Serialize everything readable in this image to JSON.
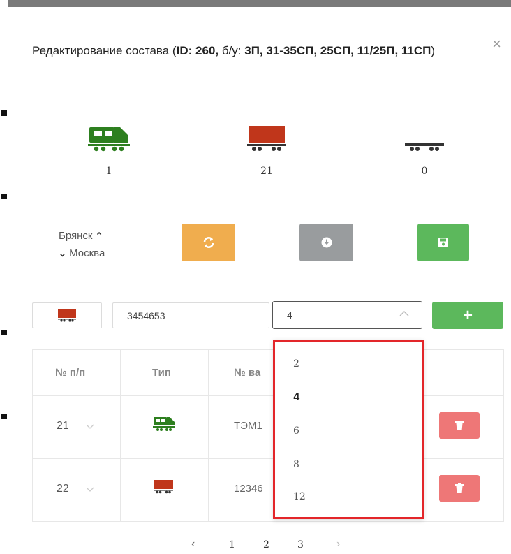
{
  "modal": {
    "title_prefix": "Редактирование состава (",
    "title_id": "ID: 260,",
    "title_mid": " б/у: ",
    "title_tracks": "3П, 31-35СП, 25СП, 11/25П, 11СП",
    "title_suffix": ")",
    "close_glyph": "×"
  },
  "counts": {
    "locomotive": "1",
    "wagon": "21",
    "platform": "0"
  },
  "route": {
    "from": "Брянск",
    "to": "Москва"
  },
  "form": {
    "wagon_number_value": "3454653",
    "select_value": "4",
    "add_label": "+"
  },
  "table": {
    "headers": [
      "№ п/п",
      "Тип",
      "№ ва"
    ],
    "rows": [
      {
        "num": "21",
        "type": "locomotive",
        "wagon": "ТЭМ1"
      },
      {
        "num": "22",
        "type": "wagon",
        "wagon": "12346"
      }
    ]
  },
  "dropdown": {
    "options": [
      "2",
      "4",
      "6",
      "8",
      "12"
    ],
    "selected": "4"
  },
  "pagination": {
    "pages": [
      "1",
      "2",
      "3"
    ],
    "prev": "‹",
    "next": "›"
  },
  "colors": {
    "locomotive_green": "#2d7f1f",
    "wagon_red": "#c0361b",
    "refresh_orange": "#f0ad4e",
    "download_gray": "#999c9e",
    "save_green": "#5cb85c",
    "delete_red": "#ee7777",
    "dropdown_highlight": "#e3262a"
  },
  "icons": {
    "refresh": "refresh-icon",
    "download": "download-icon",
    "save": "save-icon",
    "delete": "trash-icon"
  }
}
